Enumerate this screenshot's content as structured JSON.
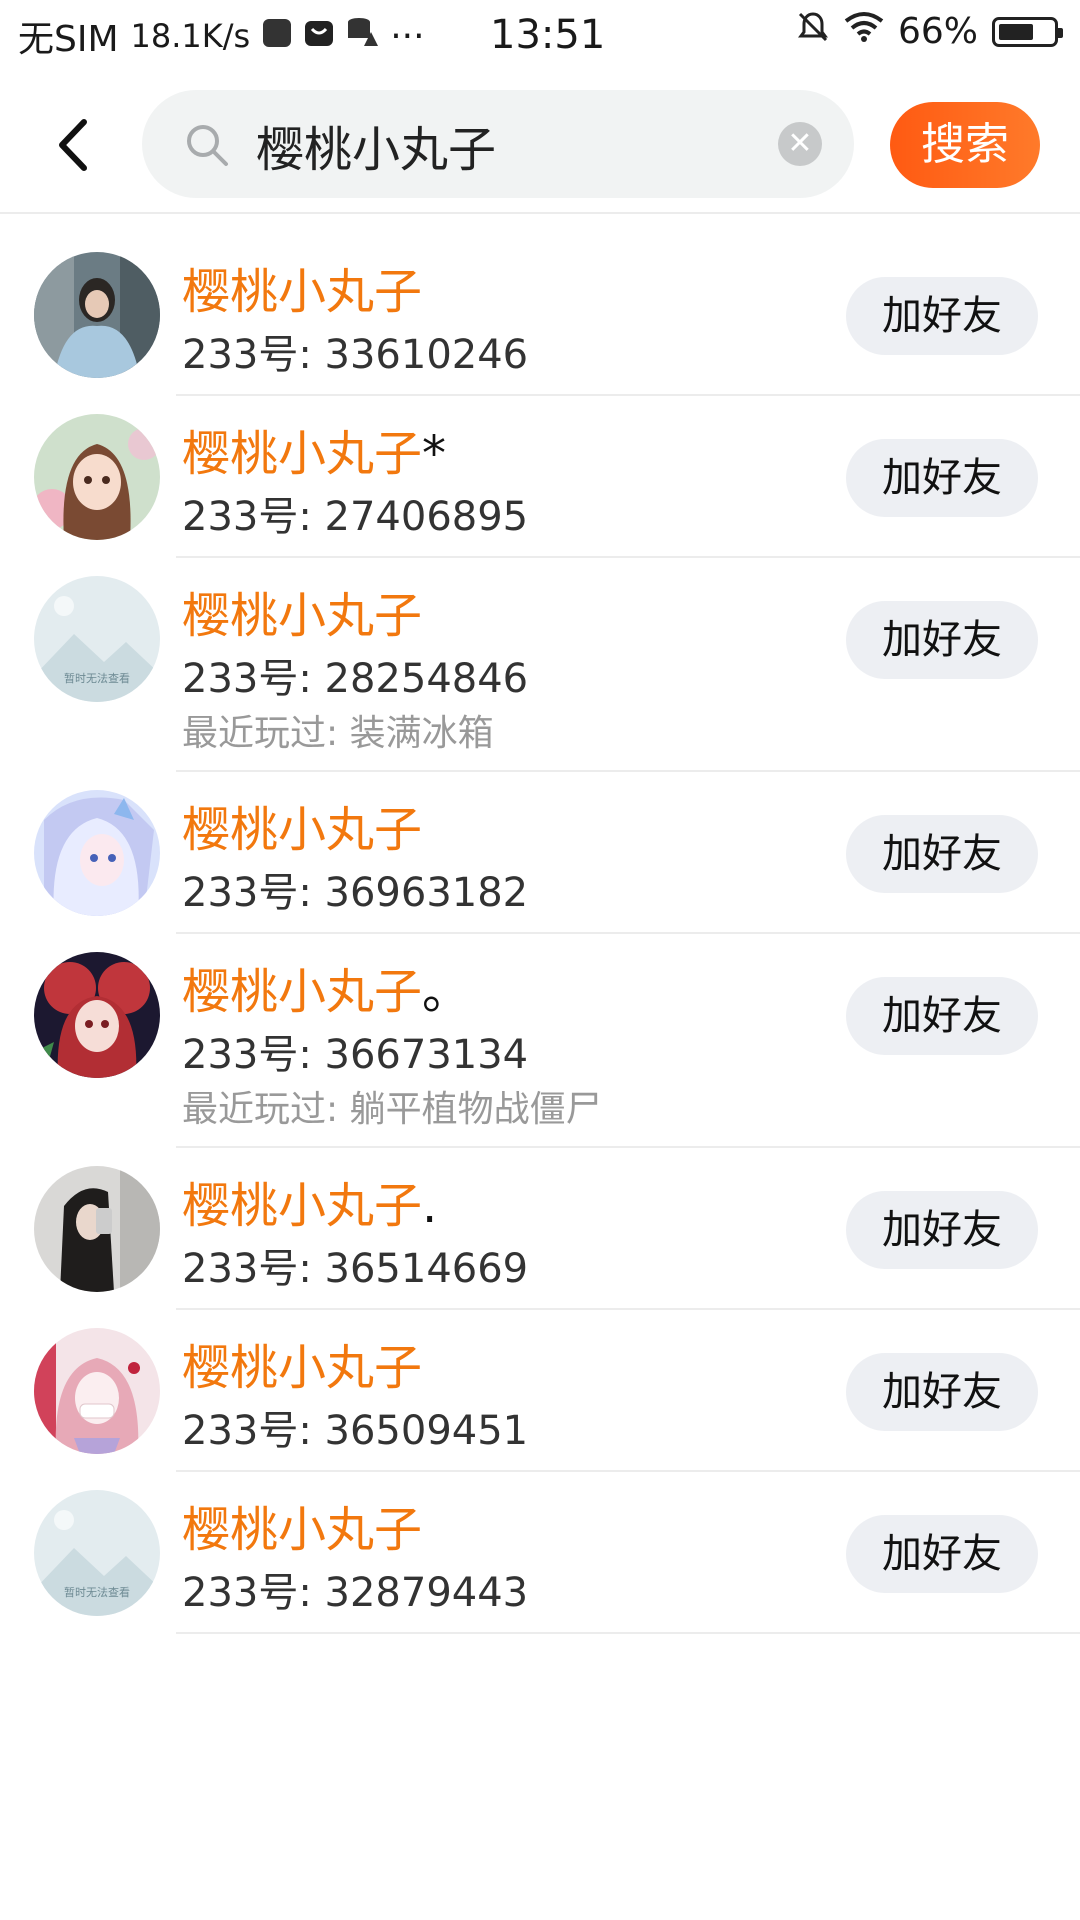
{
  "status_bar": {
    "carrier": "无SIM",
    "speed": "18.1K/s",
    "more": "···",
    "time": "13:51",
    "battery_pct": "66%",
    "battery_level": 0.66
  },
  "search": {
    "query": "樱桃小丸子",
    "button_label": "搜索"
  },
  "results": [
    {
      "name": "樱桃小丸子",
      "suffix": "",
      "id": "233号: 33610246",
      "played": "",
      "button": "加好友",
      "avatar": "photo-a"
    },
    {
      "name": "樱桃小丸子",
      "suffix": "*",
      "id": "233号: 27406895",
      "played": "",
      "button": "加好友",
      "avatar": "anime-girl-a"
    },
    {
      "name": "樱桃小丸子",
      "suffix": "",
      "id": "233号: 28254846",
      "played": "最近玩过: 装满冰箱",
      "button": "加好友",
      "avatar": "placeholder",
      "avatar_text": "暂时无法查看"
    },
    {
      "name": "樱桃小丸子",
      "suffix": "",
      "id": "233号: 36963182",
      "played": "",
      "button": "加好友",
      "avatar": "anime-girl-b"
    },
    {
      "name": "樱桃小丸子",
      "suffix": "。",
      "id": "233号: 36673134",
      "played": "最近玩过: 躺平植物战僵尸",
      "button": "加好友",
      "avatar": "anime-girl-c"
    },
    {
      "name": "樱桃小丸子",
      "suffix": ".",
      "id": "233号: 36514669",
      "played": "",
      "button": "加好友",
      "avatar": "photo-b"
    },
    {
      "name": "樱桃小丸子",
      "suffix": "",
      "id": "233号: 36509451",
      "played": "",
      "button": "加好友",
      "avatar": "anime-girl-d"
    },
    {
      "name": "樱桃小丸子",
      "suffix": "",
      "id": "233号: 32879443",
      "played": "",
      "button": "加好友",
      "avatar": "placeholder",
      "avatar_text": "暂时无法查看"
    }
  ],
  "colors": {
    "accent": "#f2780e",
    "search_button": "#ff6b1a",
    "add_button_bg": "#edeff3"
  }
}
